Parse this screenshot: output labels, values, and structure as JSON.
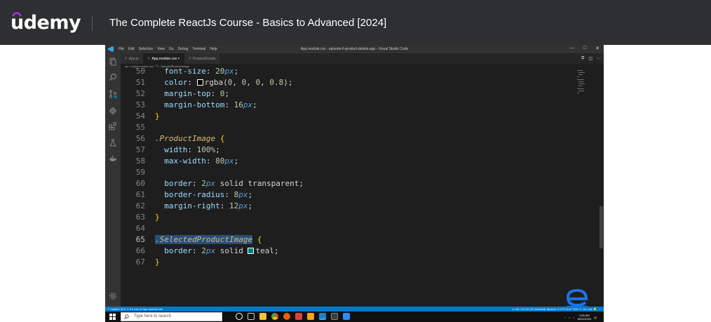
{
  "header": {
    "logo_text": "udemy",
    "course_title": "The Complete ReactJs Course - Basics to Advanced [2024]"
  },
  "vscode": {
    "menu": [
      "File",
      "Edit",
      "Selection",
      "View",
      "Go",
      "Debug",
      "Terminal",
      "Help"
    ],
    "window_title": "App.module.css - episode-6-product-details-app - Visual Studio Code",
    "window_controls": [
      "—",
      "□",
      "✕"
    ],
    "tabs": [
      {
        "label": "App.js"
      },
      {
        "label": "App.module.css ×"
      },
      {
        "label": "ProductDetails"
      }
    ],
    "breadcrumb": "src › # App.module.css › 🏷 .SelectedProductImage",
    "code_lines": [
      {
        "n": "50",
        "text": "font-size: 20px;"
      },
      {
        "n": "51",
        "text": "color: rgba(0, 0, 0, 0.8);"
      },
      {
        "n": "52",
        "text": "margin-top: 0;"
      },
      {
        "n": "53",
        "text": "margin-bottom: 16px;"
      },
      {
        "n": "54",
        "text": "}"
      },
      {
        "n": "55",
        "text": ""
      },
      {
        "n": "56",
        "text": ".ProductImage {"
      },
      {
        "n": "57",
        "text": "width: 100%;"
      },
      {
        "n": "58",
        "text": "max-width: 80px;"
      },
      {
        "n": "59",
        "text": ""
      },
      {
        "n": "60",
        "text": "border: 2px solid transparent;"
      },
      {
        "n": "61",
        "text": "border-radius: 8px;"
      },
      {
        "n": "62",
        "text": "margin-right: 12px;"
      },
      {
        "n": "63",
        "text": "}"
      },
      {
        "n": "64",
        "text": ""
      },
      {
        "n": "65",
        "text": ".SelectedProductImage {"
      },
      {
        "n": "66",
        "text": "border: 2px solid teal;"
      },
      {
        "n": "67",
        "text": "}"
      }
    ],
    "status_left": "ᚠ master*  ⊗ 0 ⚠ 0   ▸ css | ▸ App.module.css",
    "status_right": "Ln 65, Col 22 (20 selected)   Spaces: 2   UTF-8   LF   CSS   ☺ Go Live   🔔",
    "colors": {
      "swatch_black": "#000000",
      "swatch_teal": "#008080",
      "status_bar": "#007acc"
    }
  },
  "taskbar": {
    "search_placeholder": "Type here to search",
    "clock_time": "1:53 AM",
    "clock_date": "18/01/2024"
  }
}
